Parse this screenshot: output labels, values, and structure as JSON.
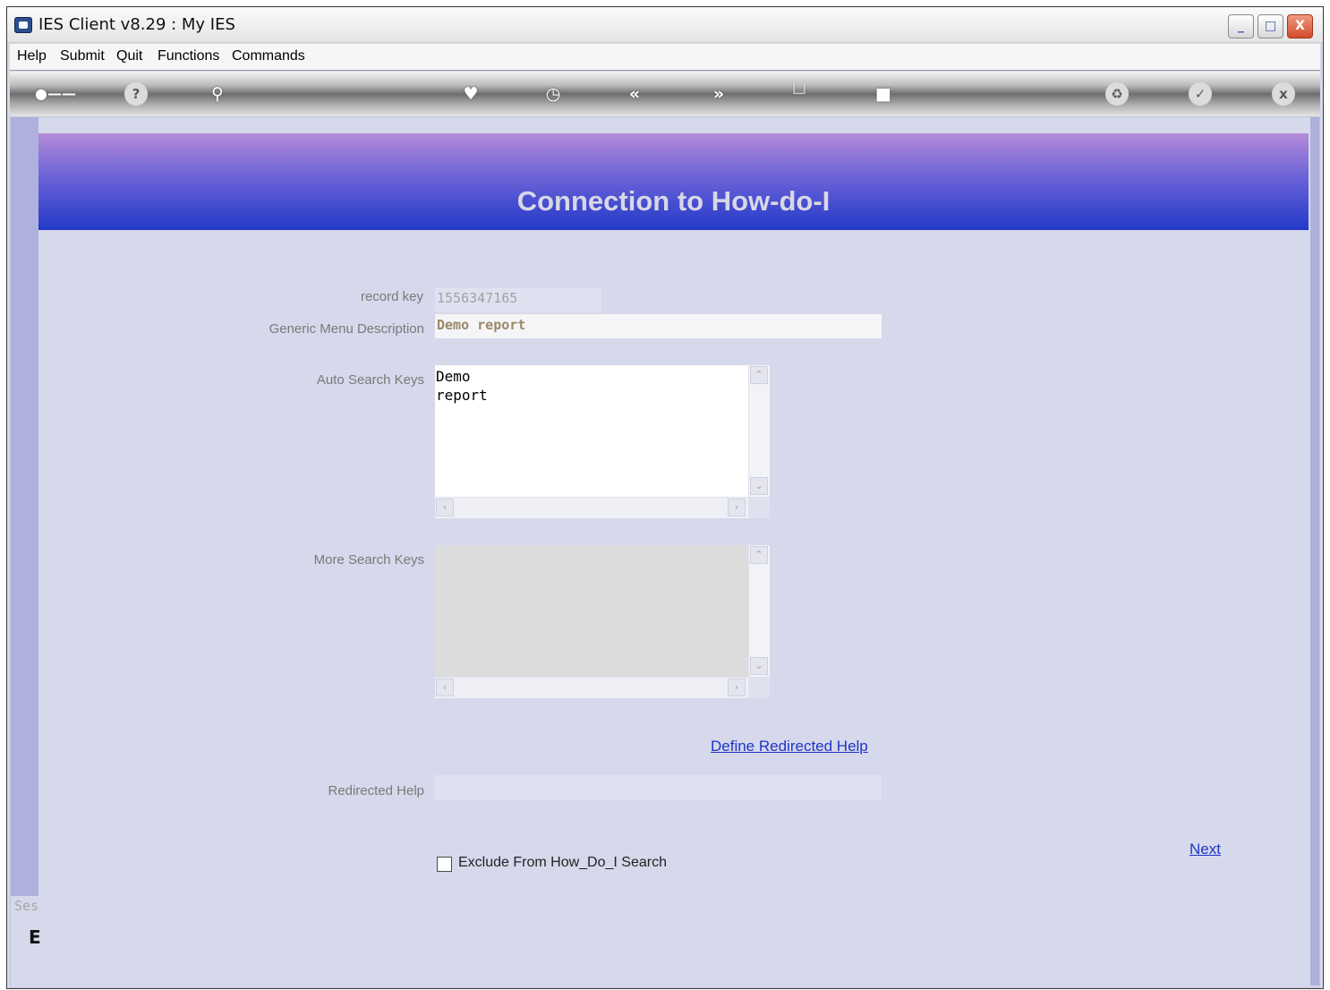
{
  "window": {
    "title": "IES Client v8.29 : My IES",
    "controls": {
      "minimize": "_",
      "maximize": "□",
      "close": "X"
    }
  },
  "menubar": {
    "items": [
      "Help",
      "Submit",
      "Quit",
      "Functions",
      "Commands"
    ]
  },
  "toolbar": {
    "icons": [
      "key-icon",
      "help-icon",
      "search-icon",
      "heart-icon",
      "clock-icon",
      "rewind-icon",
      "fast-forward-icon",
      "tree-icon",
      "stop-icon",
      "recycle-icon",
      "check-icon",
      "close-icon"
    ]
  },
  "page": {
    "title": "Connection to How-do-I"
  },
  "form": {
    "record_key_label": "record key",
    "record_key_value": "1556347165",
    "menu_desc_label": "Generic Menu Description",
    "menu_desc_value": "Demo report",
    "auto_keys_label": "Auto Search Keys",
    "auto_keys_value": "Demo\nreport",
    "more_keys_label": "More Search Keys",
    "more_keys_value": "",
    "define_redirect_link": "Define Redirected Help",
    "redirected_label": "Redirected Help",
    "redirected_value": "",
    "exclude_label": "Exclude From How_Do_I Search",
    "exclude_checked": false,
    "next_link": "Next"
  },
  "side": {
    "fragment_1": "Ses",
    "fragment_2": "E"
  },
  "colors": {
    "header_top": "#b58bd9",
    "header_bottom": "#2339c7",
    "content_bg": "#d6d8eb",
    "link": "#1d35c9"
  }
}
